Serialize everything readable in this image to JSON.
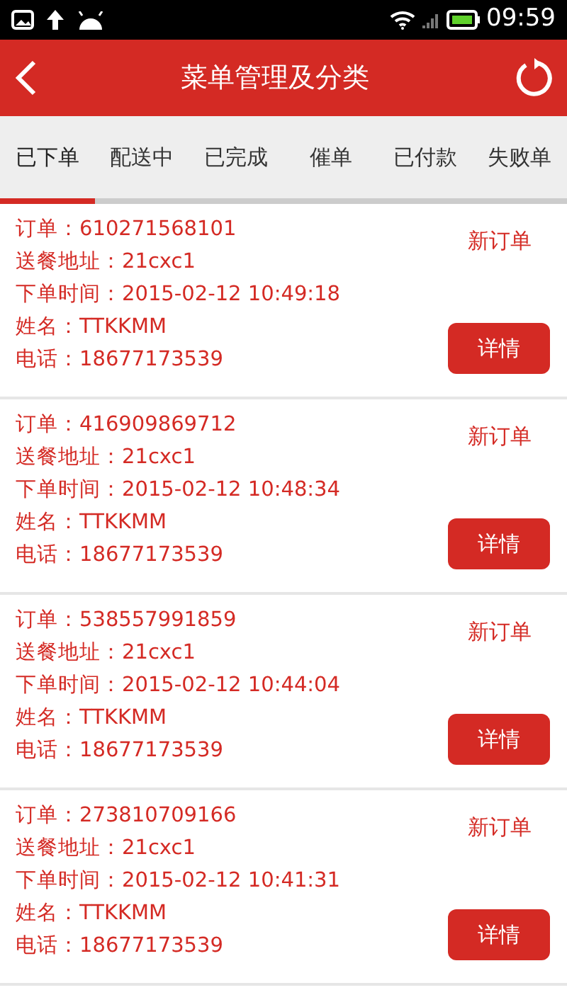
{
  "status_bar": {
    "time": "09:59"
  },
  "header": {
    "title": "菜单管理及分类"
  },
  "tabs": [
    {
      "label": "已下单",
      "selected": true
    },
    {
      "label": "配送中",
      "selected": false
    },
    {
      "label": "已完成",
      "selected": false
    },
    {
      "label": "催单",
      "selected": false
    },
    {
      "label": "已付款",
      "selected": false
    },
    {
      "label": "失败单",
      "selected": false
    }
  ],
  "orders": [
    {
      "lines": [
        "订单：610271568101",
        "送餐地址：21cxc1",
        "下单时间：2015-02-12 10:49:18",
        "姓名：TTKKMM",
        "电话：18677173539"
      ],
      "status": "新订单",
      "button": "详情"
    },
    {
      "lines": [
        "订单：416909869712",
        "送餐地址：21cxc1",
        "下单时间：2015-02-12 10:48:34",
        "姓名：TTKKMM",
        "电话：18677173539"
      ],
      "status": "新订单",
      "button": "详情"
    },
    {
      "lines": [
        "订单：538557991859",
        "送餐地址：21cxc1",
        "下单时间：2015-02-12 10:44:04",
        "姓名：TTKKMM",
        "电话：18677173539"
      ],
      "status": "新订单",
      "button": "详情"
    },
    {
      "lines": [
        "订单：273810709166",
        "送餐地址：21cxc1",
        "下单时间：2015-02-12 10:41:31",
        "姓名：TTKKMM",
        "电话：18677173539"
      ],
      "status": "新订单",
      "button": "详情"
    }
  ]
}
